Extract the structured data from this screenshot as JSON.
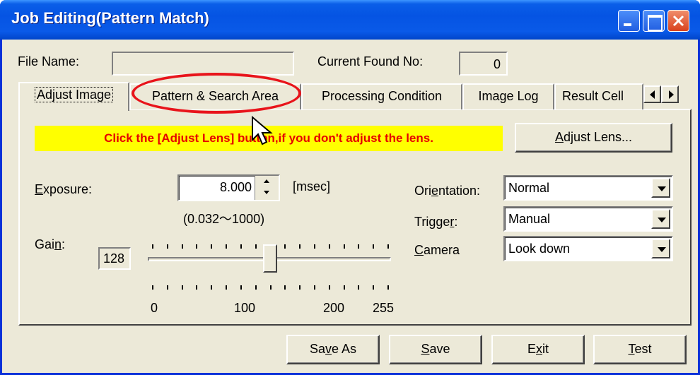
{
  "window": {
    "title": "Job Editing(Pattern Match)"
  },
  "header": {
    "file_name_label": "File Name:",
    "file_name_value": "",
    "current_found_label": "Current Found No:",
    "current_found_value": "0"
  },
  "tabs": [
    {
      "label": "Adjust Image",
      "active": true
    },
    {
      "label": "Pattern & Search Area",
      "active": false
    },
    {
      "label": "Processing Condition",
      "active": false
    },
    {
      "label": "Image Log",
      "active": false
    },
    {
      "label": "Result Cell",
      "active": false
    }
  ],
  "notice": {
    "text": "Click the [Adjust Lens] button,if you don't adjust the lens.",
    "color": "#e60000",
    "background": "#ffff00"
  },
  "adjust_lens_button": {
    "label_pre": "A",
    "label_post": "djust Lens..."
  },
  "exposure": {
    "label_pre": "E",
    "label_post": "xposure:",
    "value": "8.000",
    "unit": "[msec]",
    "range": "(0.032～1000)"
  },
  "gain": {
    "label_pre": "Gai",
    "label_key": "n",
    "label_post": ":",
    "value": "128",
    "slider_value": 128,
    "slider_min": 0,
    "slider_max": 255,
    "scale_labels": [
      "0",
      "100",
      "200",
      "255"
    ]
  },
  "orientation": {
    "label_pre": "Ori",
    "label_key": "e",
    "label_post": "ntation:",
    "value": "Normal"
  },
  "trigger": {
    "label_pre": "Trigge",
    "label_key": "r",
    "label_post": ":",
    "value": "Manual"
  },
  "camera": {
    "label_key": "C",
    "label_post": "amera",
    "value": "Look down"
  },
  "buttons": {
    "save_as": {
      "pre": "Sa",
      "key": "v",
      "post": "e As"
    },
    "save": {
      "key": "S",
      "post": "ave"
    },
    "exit": {
      "pre": "E",
      "key": "x",
      "post": "it"
    },
    "test": {
      "key": "T",
      "post": "est"
    }
  },
  "annotation_color": "#e8141b"
}
